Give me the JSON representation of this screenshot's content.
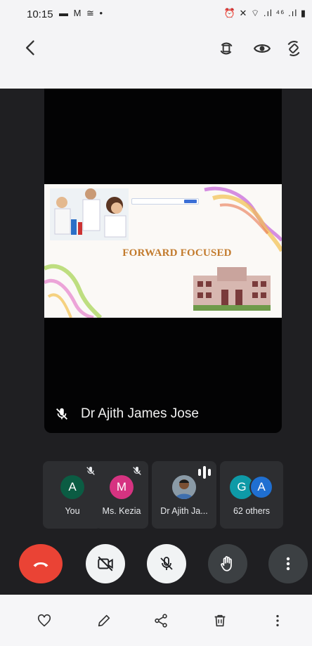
{
  "status_bar": {
    "time": "10:15",
    "left_icons": "▬ M ≅ •",
    "right_icons": "⏰ ✕ ⌔ .ıl ⁴⁶ .ıl ▮"
  },
  "app_bar": {
    "back_icon": "chevron-left-icon",
    "icons": [
      "rotate-screen-icon",
      "eye-icon",
      "auto-rotate-icon"
    ]
  },
  "presentation": {
    "slide_title": "FORWARD FOCUSED",
    "speaker_name": "Dr Ajith James Jose"
  },
  "participants": [
    {
      "initial": "A",
      "label": "You",
      "color": "#0b5c43",
      "muted": true
    },
    {
      "initial": "M",
      "label": "Ms. Kezia",
      "color": "#d63381",
      "muted": true
    },
    {
      "initial": "",
      "label": "Dr Ajith Ja...",
      "color": "#5b6b7a",
      "speaking": true
    },
    {
      "initial_1": "G",
      "initial_2": "A",
      "label": "62 others",
      "color_1": "#0e9aa7",
      "color_2": "#1f6fd1"
    }
  ],
  "controls": [
    "end-call",
    "camera-off",
    "mic-off",
    "raise-hand",
    "more-options"
  ],
  "colors": {
    "end_call": "#ea4335",
    "dark_bg": "#1f1f22",
    "tile_bg": "#2d2e31"
  }
}
